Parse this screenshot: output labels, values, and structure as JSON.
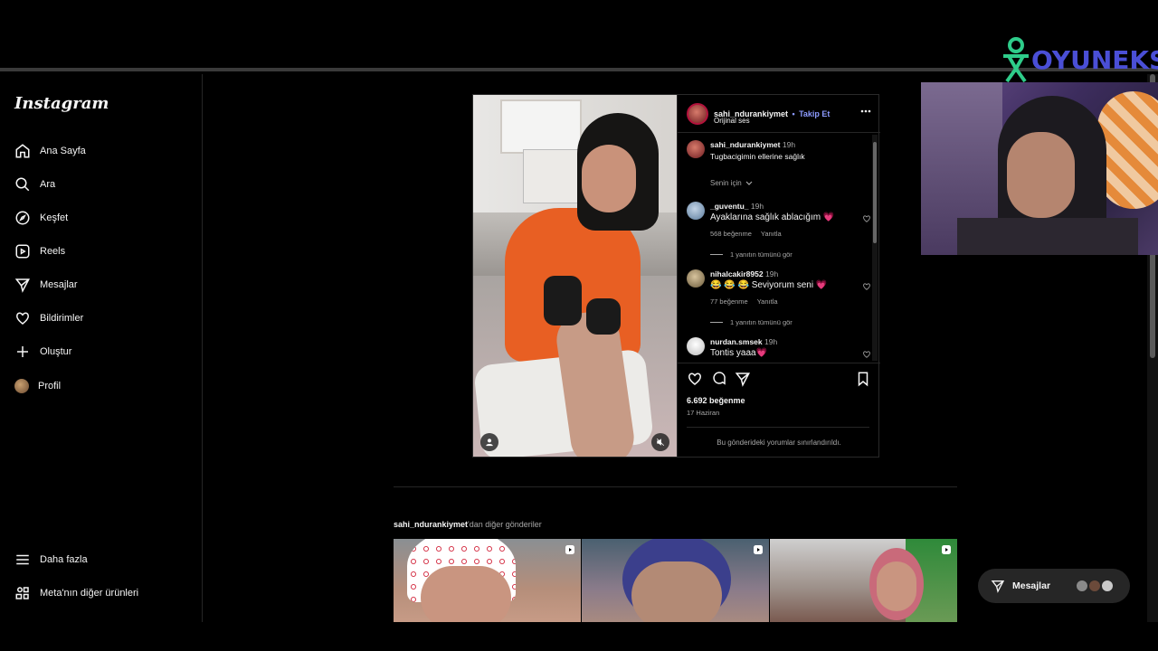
{
  "sidebar": {
    "logo": "Instagram",
    "items": [
      {
        "label": "Ana Sayfa",
        "icon": "home-icon"
      },
      {
        "label": "Ara",
        "icon": "search-icon"
      },
      {
        "label": "Keşfet",
        "icon": "compass-icon"
      },
      {
        "label": "Reels",
        "icon": "reels-icon"
      },
      {
        "label": "Mesajlar",
        "icon": "send-icon"
      },
      {
        "label": "Bildirimler",
        "icon": "heart-icon"
      },
      {
        "label": "Oluştur",
        "icon": "plus-icon"
      },
      {
        "label": "Profil",
        "icon": "avatar-icon"
      }
    ],
    "bottom": [
      {
        "label": "Daha fazla",
        "icon": "menu-icon"
      },
      {
        "label": "Meta'nın diğer ürünleri",
        "icon": "grid-icon"
      }
    ]
  },
  "post": {
    "author": "sahi_ndurankiymet",
    "separator": "•",
    "follow_label": "Takip Et",
    "audio": "Orijinal ses",
    "caption_author": "sahi_ndurankiymet",
    "caption_time": "19h",
    "caption_text": "Tugbacigimin ellerine sağlık",
    "for_you": "Senin için",
    "comments": [
      {
        "user": "_guventu_",
        "time": "19h",
        "text": "Ayaklarına sağlık ablacığım 💗",
        "likes": "568 beğenme",
        "reply": "Yanıtla",
        "view_replies": "1 yanıtın tümünü gör"
      },
      {
        "user": "nihalcakir8952",
        "time": "19h",
        "text": "😂 😂 😂 Seviyorum seni 💗",
        "likes": "77 beğenme",
        "reply": "Yanıtla",
        "view_replies": "1 yanıtın tümünü gör"
      },
      {
        "user": "nurdan.smsek",
        "time": "19h",
        "text": "Tontis yaaa💗"
      }
    ],
    "likes": "6.692 beğenme",
    "date": "17 Haziran",
    "comments_limited": "Bu gönderideki yorumlar sınırlandırıldı."
  },
  "more": {
    "user": "sahi_ndurankiymet",
    "suffix": "'dan diğer gönderiler"
  },
  "messages_pill": {
    "label": "Mesajlar"
  },
  "overlay": {
    "brand": "OYUNEKS"
  },
  "colors": {
    "accent": "#8c9bff",
    "bg": "#000000",
    "panel": "#262626",
    "brand": "#4a4fd6"
  }
}
